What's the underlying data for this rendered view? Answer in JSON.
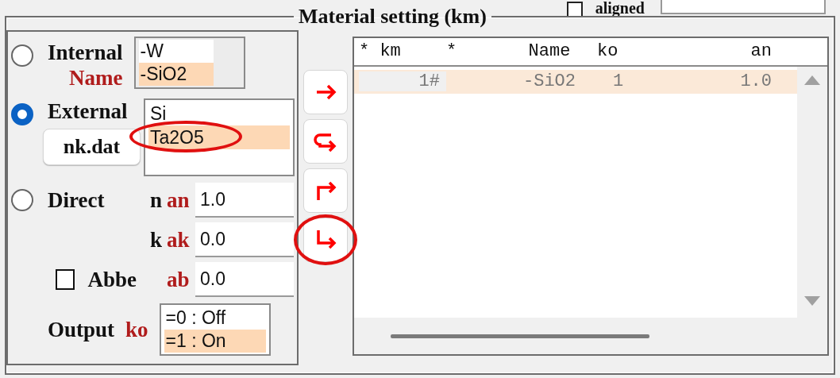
{
  "top": {
    "aligned": {
      "label": "aligned",
      "checked": false
    }
  },
  "group_title": "Material setting (km)",
  "internal": {
    "label": "Internal",
    "param": "Name",
    "selected": false,
    "items": [
      {
        "text": "-W",
        "selected": false,
        "circled": false
      },
      {
        "text": "-SiO2",
        "selected": true,
        "circled": false
      }
    ]
  },
  "external": {
    "label": "External",
    "selected": true,
    "button": "nk.dat",
    "items": [
      {
        "text": "Si",
        "selected": false,
        "circled": false
      },
      {
        "text": "Ta2O5",
        "selected": true,
        "circled": true
      }
    ]
  },
  "direct": {
    "label": "Direct",
    "selected": false,
    "fields": [
      {
        "symbol": "n",
        "param": "an",
        "value": "1.0"
      },
      {
        "symbol": "k",
        "param": "ak",
        "value": "0.0"
      }
    ]
  },
  "abbe": {
    "label": "Abbe",
    "checked": false,
    "param": "ab",
    "value": "0.0"
  },
  "output": {
    "label": "Output",
    "param": "ko",
    "items": [
      {
        "text": "=0 : Off",
        "selected": false
      },
      {
        "text": "=1 : On",
        "selected": true
      }
    ]
  },
  "transfer_buttons": [
    {
      "kind": "right",
      "circled": false
    },
    {
      "kind": "hook",
      "circled": false
    },
    {
      "kind": "up-right",
      "circled": false
    },
    {
      "kind": "down-right",
      "circled": true
    }
  ],
  "table": {
    "columns": [
      "* km",
      "*",
      "Name",
      "ko",
      "an"
    ],
    "rows": [
      {
        "km": "1#",
        "name": "-SiO2",
        "ko": "1",
        "an": "1.0",
        "selected": true
      }
    ]
  }
}
